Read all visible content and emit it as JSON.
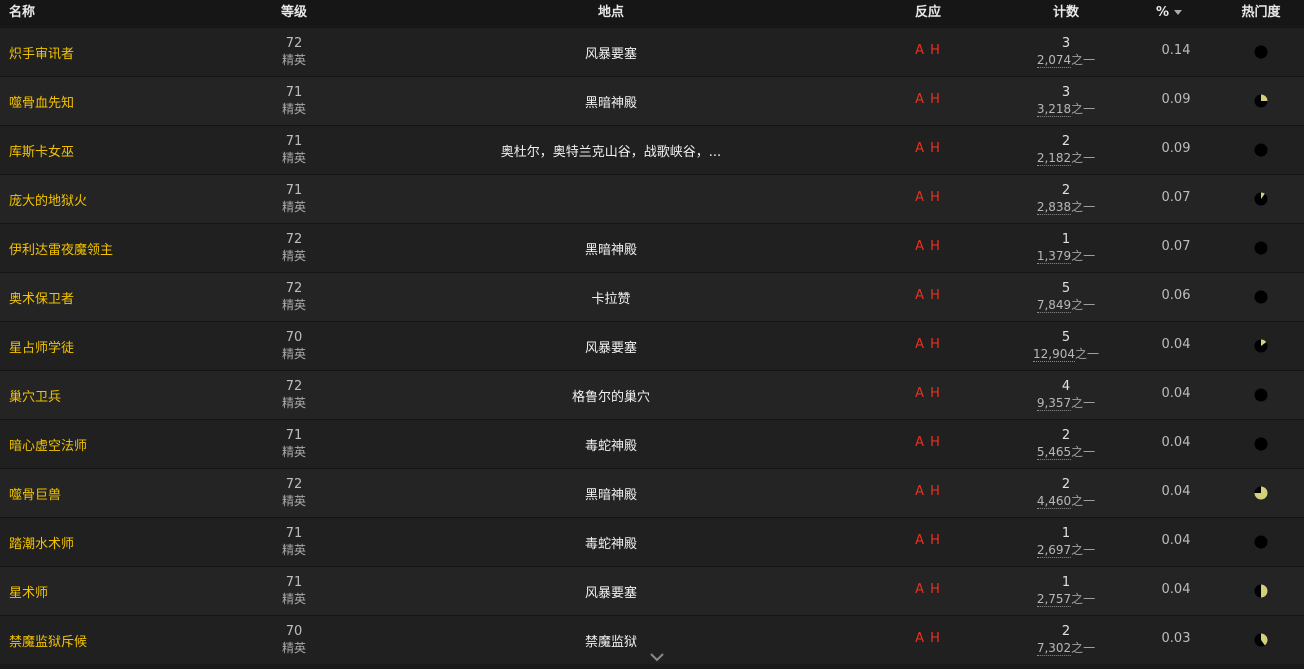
{
  "header": {
    "name": "名称",
    "level": "等级",
    "location": "地点",
    "reaction": "反应",
    "count": "计数",
    "percent": "%",
    "popularity": "热门度"
  },
  "count_suffix": "之一",
  "rows": [
    {
      "name": "炽手审讯者",
      "level": "72",
      "classification": "精英",
      "location": "风暴要塞",
      "reaction": "A H",
      "count": "3",
      "total": "2,074",
      "percent": "0.14",
      "popularity": 0.0
    },
    {
      "name": "噬骨血先知",
      "level": "71",
      "classification": "精英",
      "location": "黑暗神殿",
      "reaction": "A H",
      "count": "3",
      "total": "3,218",
      "percent": "0.09",
      "popularity": 0.25
    },
    {
      "name": "库斯卡女巫",
      "level": "71",
      "classification": "精英",
      "location": "奥杜尔，奥特兰克山谷，战歌峡谷，...",
      "reaction": "A H",
      "count": "2",
      "total": "2,182",
      "percent": "0.09",
      "popularity": 0.0
    },
    {
      "name": "庞大的地狱火",
      "level": "71",
      "classification": "精英",
      "location": "",
      "reaction": "A H",
      "count": "2",
      "total": "2,838",
      "percent": "0.07",
      "popularity": 0.1
    },
    {
      "name": "伊利达雷夜魔领主",
      "level": "72",
      "classification": "精英",
      "location": "黑暗神殿",
      "reaction": "A H",
      "count": "1",
      "total": "1,379",
      "percent": "0.07",
      "popularity": 0.0
    },
    {
      "name": "奥术保卫者",
      "level": "72",
      "classification": "精英",
      "location": "卡拉赞",
      "reaction": "A H",
      "count": "5",
      "total": "7,849",
      "percent": "0.06",
      "popularity": 0.0
    },
    {
      "name": "星占师学徒",
      "level": "70",
      "classification": "精英",
      "location": "风暴要塞",
      "reaction": "A H",
      "count": "5",
      "total": "12,904",
      "percent": "0.04",
      "popularity": 0.15
    },
    {
      "name": "巢穴卫兵",
      "level": "72",
      "classification": "精英",
      "location": "格鲁尔的巢穴",
      "reaction": "A H",
      "count": "4",
      "total": "9,357",
      "percent": "0.04",
      "popularity": 0.0
    },
    {
      "name": "暗心虚空法师",
      "level": "71",
      "classification": "精英",
      "location": "毒蛇神殿",
      "reaction": "A H",
      "count": "2",
      "total": "5,465",
      "percent": "0.04",
      "popularity": 0.0
    },
    {
      "name": "噬骨巨兽",
      "level": "72",
      "classification": "精英",
      "location": "黑暗神殿",
      "reaction": "A H",
      "count": "2",
      "total": "4,460",
      "percent": "0.04",
      "popularity": 0.75
    },
    {
      "name": "踏潮水术师",
      "level": "71",
      "classification": "精英",
      "location": "毒蛇神殿",
      "reaction": "A H",
      "count": "1",
      "total": "2,697",
      "percent": "0.04",
      "popularity": 0.0
    },
    {
      "name": "星术师",
      "level": "71",
      "classification": "精英",
      "location": "风暴要塞",
      "reaction": "A H",
      "count": "1",
      "total": "2,757",
      "percent": "0.04",
      "popularity": 0.5
    },
    {
      "name": "禁魔监狱斥候",
      "level": "70",
      "classification": "精英",
      "location": "禁魔监狱",
      "reaction": "A H",
      "count": "2",
      "total": "7,302",
      "percent": "0.03",
      "popularity": 0.4
    }
  ],
  "colors": {
    "name": "#f2c200",
    "reaction": "#e8321f",
    "pie_fill": "#d4d07a",
    "pie_bg": "#000000"
  },
  "icons": {
    "sort": "sort-desc-icon",
    "more": "chevron-down-icon"
  }
}
